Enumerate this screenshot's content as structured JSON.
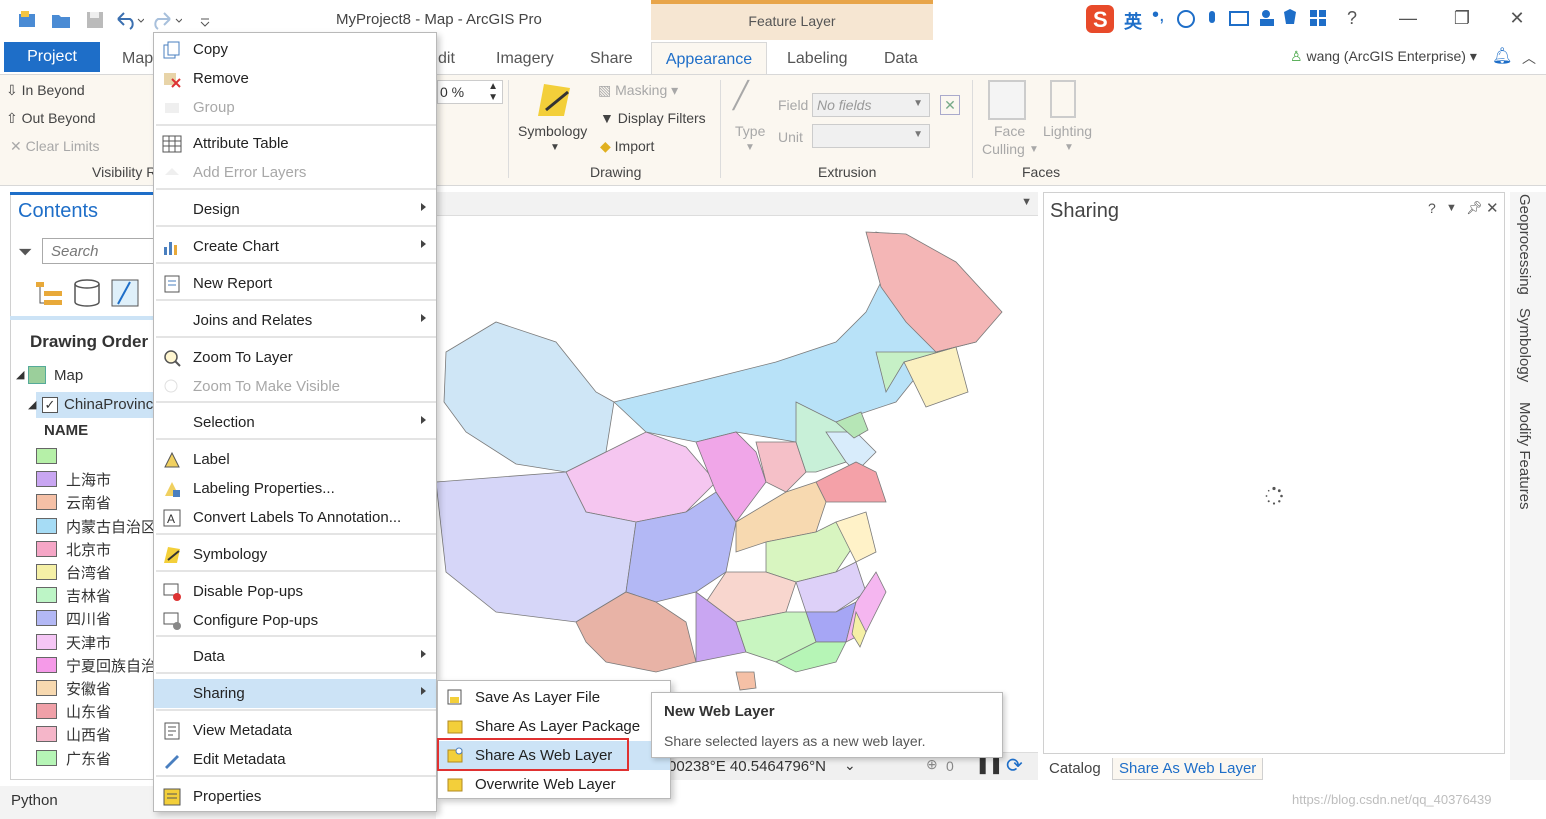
{
  "app": {
    "title": "MyProject8 - Map - ArcGIS Pro",
    "contextual_tab_group": "Feature Layer",
    "user": "wang (ArcGIS Enterprise)",
    "help": "?"
  },
  "ime": {
    "mode": "英"
  },
  "tabs": [
    {
      "label": "Project",
      "state": "active-blue"
    },
    {
      "label": "Map"
    },
    {
      "label": "dit"
    },
    {
      "label": "Imagery"
    },
    {
      "label": "Share"
    },
    {
      "label": "Appearance",
      "state": "selected"
    },
    {
      "label": "Labeling"
    },
    {
      "label": "Data"
    }
  ],
  "ribbon": {
    "visibility": {
      "in_beyond": "In Beyond",
      "out_beyond": "Out Beyond",
      "clear_limits": "Clear Limits",
      "group": "Visibility R"
    },
    "effects_value": "0 %",
    "drawing": {
      "symbology": "Symbology",
      "masking": "Masking",
      "display_filters": "Display Filters",
      "import": "Import",
      "group": "Drawing"
    },
    "extrusion": {
      "type": "Type",
      "field": "Field",
      "field_value": "No fields",
      "unit": "Unit",
      "group": "Extrusion"
    },
    "faces": {
      "face_culling_1": "Face",
      "face_culling_2": "Culling",
      "lighting": "Lighting",
      "group": "Faces"
    }
  },
  "contents": {
    "title": "Contents",
    "search_placeholder": "Search",
    "drawing_order": "Drawing Order",
    "map_node": "Map",
    "layer_node": "ChinaProvinces",
    "field_header": "NAME",
    "legend": [
      {
        "label": "",
        "color": "#b6f0a8"
      },
      {
        "label": "上海市",
        "color": "#c9a6f2"
      },
      {
        "label": "云南省",
        "color": "#f5c0a6"
      },
      {
        "label": "内蒙古自治区",
        "color": "#a6dcf5"
      },
      {
        "label": "北京市",
        "color": "#f5a6c6"
      },
      {
        "label": "台湾省",
        "color": "#f5f0a6"
      },
      {
        "label": "吉林省",
        "color": "#bdf5c6"
      },
      {
        "label": "四川省",
        "color": "#b3b8f5"
      },
      {
        "label": "天津市",
        "color": "#f5c6f5"
      },
      {
        "label": "宁夏回族自治区",
        "color": "#f59ae8"
      },
      {
        "label": "安徽省",
        "color": "#f7d9b0"
      },
      {
        "label": "山东省",
        "color": "#f0a0a8"
      },
      {
        "label": "山西省",
        "color": "#f5b6c9"
      },
      {
        "label": "广东省",
        "color": "#b6f5b6"
      }
    ]
  },
  "context_menu": {
    "items": [
      {
        "label": "Copy",
        "icon": "copy-icon",
        "enabled": true
      },
      {
        "label": "Remove",
        "icon": "remove-icon",
        "enabled": true
      },
      {
        "label": "Group",
        "icon": "group-icon",
        "enabled": false
      },
      {
        "label": "Attribute Table",
        "icon": "table-icon",
        "enabled": true
      },
      {
        "label": "Add Error Layers",
        "icon": "error-layers-icon",
        "enabled": false
      },
      {
        "label": "Design",
        "submenu": true
      },
      {
        "label": "Create Chart",
        "icon": "chart-icon",
        "submenu": true
      },
      {
        "label": "New Report",
        "icon": "report-icon"
      },
      {
        "label": "Joins and Relates",
        "submenu": true
      },
      {
        "label": "Zoom To Layer",
        "icon": "zoom-icon"
      },
      {
        "label": "Zoom To Make Visible",
        "icon": "zoom-visible-icon",
        "enabled": false
      },
      {
        "label": "Selection",
        "submenu": true
      },
      {
        "label": "Label",
        "icon": "label-icon"
      },
      {
        "label": "Labeling Properties...",
        "icon": "labeling-properties-icon"
      },
      {
        "label": "Convert Labels To Annotation...",
        "icon": "convert-labels-icon"
      },
      {
        "label": "Symbology",
        "icon": "symbology-icon"
      },
      {
        "label": "Disable Pop-ups",
        "icon": "disable-popups-icon"
      },
      {
        "label": "Configure Pop-ups",
        "icon": "configure-popups-icon"
      },
      {
        "label": "Data",
        "submenu": true
      },
      {
        "label": "Sharing",
        "submenu": true,
        "highlighted": true
      },
      {
        "label": "View Metadata",
        "icon": "metadata-icon"
      },
      {
        "label": "Edit Metadata",
        "icon": "edit-metadata-icon"
      },
      {
        "label": "Properties",
        "icon": "properties-icon"
      }
    ]
  },
  "sharing_submenu": {
    "items": [
      {
        "label": "Save As Layer File"
      },
      {
        "label": "Share As Layer Package"
      },
      {
        "label": "Share As Web Layer",
        "highlighted": true
      },
      {
        "label": "Overwrite Web Layer"
      }
    ]
  },
  "tooltip": {
    "title": "New Web Layer",
    "description": "Share selected layers as a new web layer."
  },
  "statusbar": {
    "coordinates": "00238°E 40.5464796°N",
    "selected_count": "0"
  },
  "sharing_pane": {
    "title": "Sharing",
    "tabs": [
      {
        "label": "Catalog"
      },
      {
        "label": "Share As Web Layer",
        "active": true
      }
    ],
    "side_tabs": [
      "Geoprocessing",
      "Symbology",
      "Modify Features"
    ]
  },
  "bottom": {
    "python": "Python",
    "watermark": "https://blog.csdn.net/qq_40376439"
  },
  "colors": {
    "accent": "#1e6ec8",
    "highlight": "#cce3f6",
    "callout": "#e03131"
  }
}
